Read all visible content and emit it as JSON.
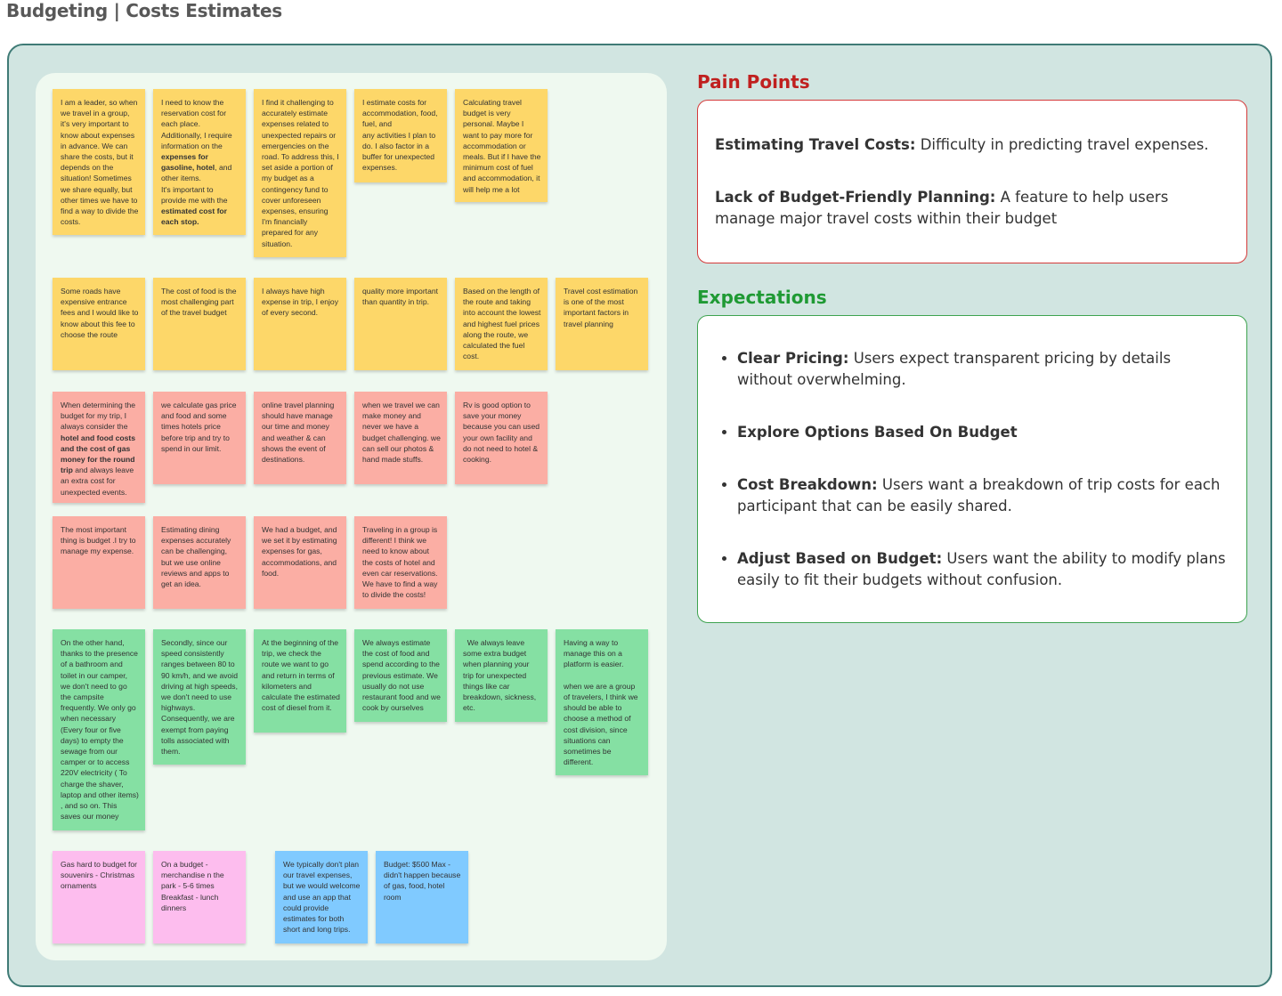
{
  "page": {
    "title": "Budgeting | Costs Estimates"
  },
  "stickies": [
    {
      "color": "yellow",
      "html": "I am a leader, so when we travel in a group, it's very important to know about expenses in advance. We can share the costs, but it depends on the situation! Sometimes we share equally, but other times we have to find a way to divide the costs."
    },
    {
      "color": "yellow",
      "html": "I need to know the reservation cost for each place. Additionally, I require information on the <b>expenses for gasoline, hotel</b>, and other items.\nIt's important to provide me with the <b>estimated cost for each stop.</b>"
    },
    {
      "color": "yellow",
      "html": "I find it challenging to accurately estimate expenses related to unexpected repairs or emergencies on the road. To address this, I set aside a portion of my budget as a contingency fund to cover unforeseen expenses, ensuring I'm financially prepared for any situation."
    },
    {
      "color": "yellow",
      "html": "I estimate costs for accommodation, food, fuel, and\nany activities I plan to do. I also factor in a buffer for unexpected expenses."
    },
    {
      "color": "yellow",
      "html": "Calculating travel budget is very personal. Maybe I want to pay more for accommodation or meals. But if I have the minimum cost of fuel and accommodation, it will help me a lot"
    },
    {
      "color": "yellow",
      "html": "Some roads have expensive entrance fees and I would like to know about this fee to choose the route"
    },
    {
      "color": "yellow",
      "html": "The cost of food is the most challenging part of the travel budget"
    },
    {
      "color": "yellow",
      "html": "I always have high expense in trip, I enjoy of every second."
    },
    {
      "color": "yellow",
      "html": "quality more important than quantity in trip."
    },
    {
      "color": "yellow",
      "html": "Based on the length of the route and taking into account the lowest and highest fuel prices along the route, we calculated the fuel cost."
    },
    {
      "color": "yellow",
      "html": "Travel cost estimation is one of the most important factors in travel planning"
    },
    {
      "color": "red",
      "html": "When determining the budget for my trip, I always consider the <b>hotel and food costs and the cost of gas money for the round trip</b> and always leave an extra cost for unexpected events."
    },
    {
      "color": "red",
      "html": "we calculate gas price and food and some times hotels price before trip and try to spend in our limit."
    },
    {
      "color": "red",
      "html": "online travel planning should have manage our time and money and weather &amp; can shows the event of destinations."
    },
    {
      "color": "red",
      "html": "when we travel we can make money and never we have a budget challenging. we can sell our photos &amp; hand made stuffs."
    },
    {
      "color": "red",
      "html": "Rv is good option to save your money because you can used your own facility and do not need to hotel &amp; cooking."
    },
    {
      "color": "red",
      "html": "The most important thing is budget .I try to manage my expense."
    },
    {
      "color": "red",
      "html": "Estimating dining expenses accurately can be challenging, but we use online reviews and apps to get an idea."
    },
    {
      "color": "red",
      "html": "We had a budget, and we set it by estimating expenses for gas, accommodations, and food."
    },
    {
      "color": "red",
      "html": "Traveling in a group is different! I think we need to know about the costs of hotel and even car reservations. We have to find a way to divide the costs!"
    },
    {
      "color": "green",
      "html": "On the other hand, thanks to the presence of a bathroom and toilet in our camper, we don't need to go the campsite frequently. We only go when necessary (Every four or five days) to empty the sewage from our camper or to access 220V electricity ( To charge the shaver, laptop and other items) , and so on. This saves our money"
    },
    {
      "color": "green",
      "html": "Secondly, since our speed consistently ranges between 80 to 90 km/h, and we avoid driving at high speeds, we don't need to use highways. Consequently, we are exempt from paying tolls associated with them."
    },
    {
      "color": "green",
      "html": "At the beginning of the trip, we check the route we want to go and return in terms of kilometers and calculate the estimated cost of diesel from it."
    },
    {
      "color": "green",
      "html": "We always estimate the cost of food and spend according to the previous estimate. We usually do not use restaurant food and we cook by ourselves"
    },
    {
      "color": "green",
      "html": "  We always leave some extra budget when planning your trip for unexpected things like car breakdown, sickness, etc."
    },
    {
      "color": "green",
      "html": "Having a way to manage this on a platform is easier.\n\nwhen we are a group of travelers, I think we should be able to choose a method of cost division, since situations can sometimes be different."
    },
    {
      "color": "pink",
      "html": "Gas hard to budget for souvenirs - Christmas ornaments"
    },
    {
      "color": "pink",
      "html": "On a budget - merchandise n the park - 5-6 times Breakfast - lunch dinners"
    },
    {
      "color": "blue",
      "html": "We typically don't plan our travel expenses, but we would welcome and use an app that could provide estimates for both short and long trips."
    },
    {
      "color": "blue",
      "html": "Budget: $500 Max - didn't happen because of gas, food, hotel room"
    }
  ],
  "pain_points": {
    "heading": "Pain Points",
    "items": [
      {
        "label": "Estimating Travel Costs:",
        "text": " Difficulty in predicting travel expenses."
      },
      {
        "label": "Lack of Budget-Friendly Planning:",
        "text": " A feature to help users manage major travel costs within their budget"
      }
    ]
  },
  "expectations": {
    "heading": "Expectations",
    "items": [
      {
        "label": "Clear Pricing:",
        "text": " Users expect transparent pricing by details without overwhelming."
      },
      {
        "label": "Explore Options Based On Budget",
        "text": ""
      },
      {
        "label": "Cost Breakdown:",
        "text": " Users want a breakdown of trip costs for each participant that can be easily shared."
      },
      {
        "label": "Adjust Based on Budget:",
        "text": " Users want the ability to modify plans easily to fit their budgets without confusion."
      }
    ]
  }
}
